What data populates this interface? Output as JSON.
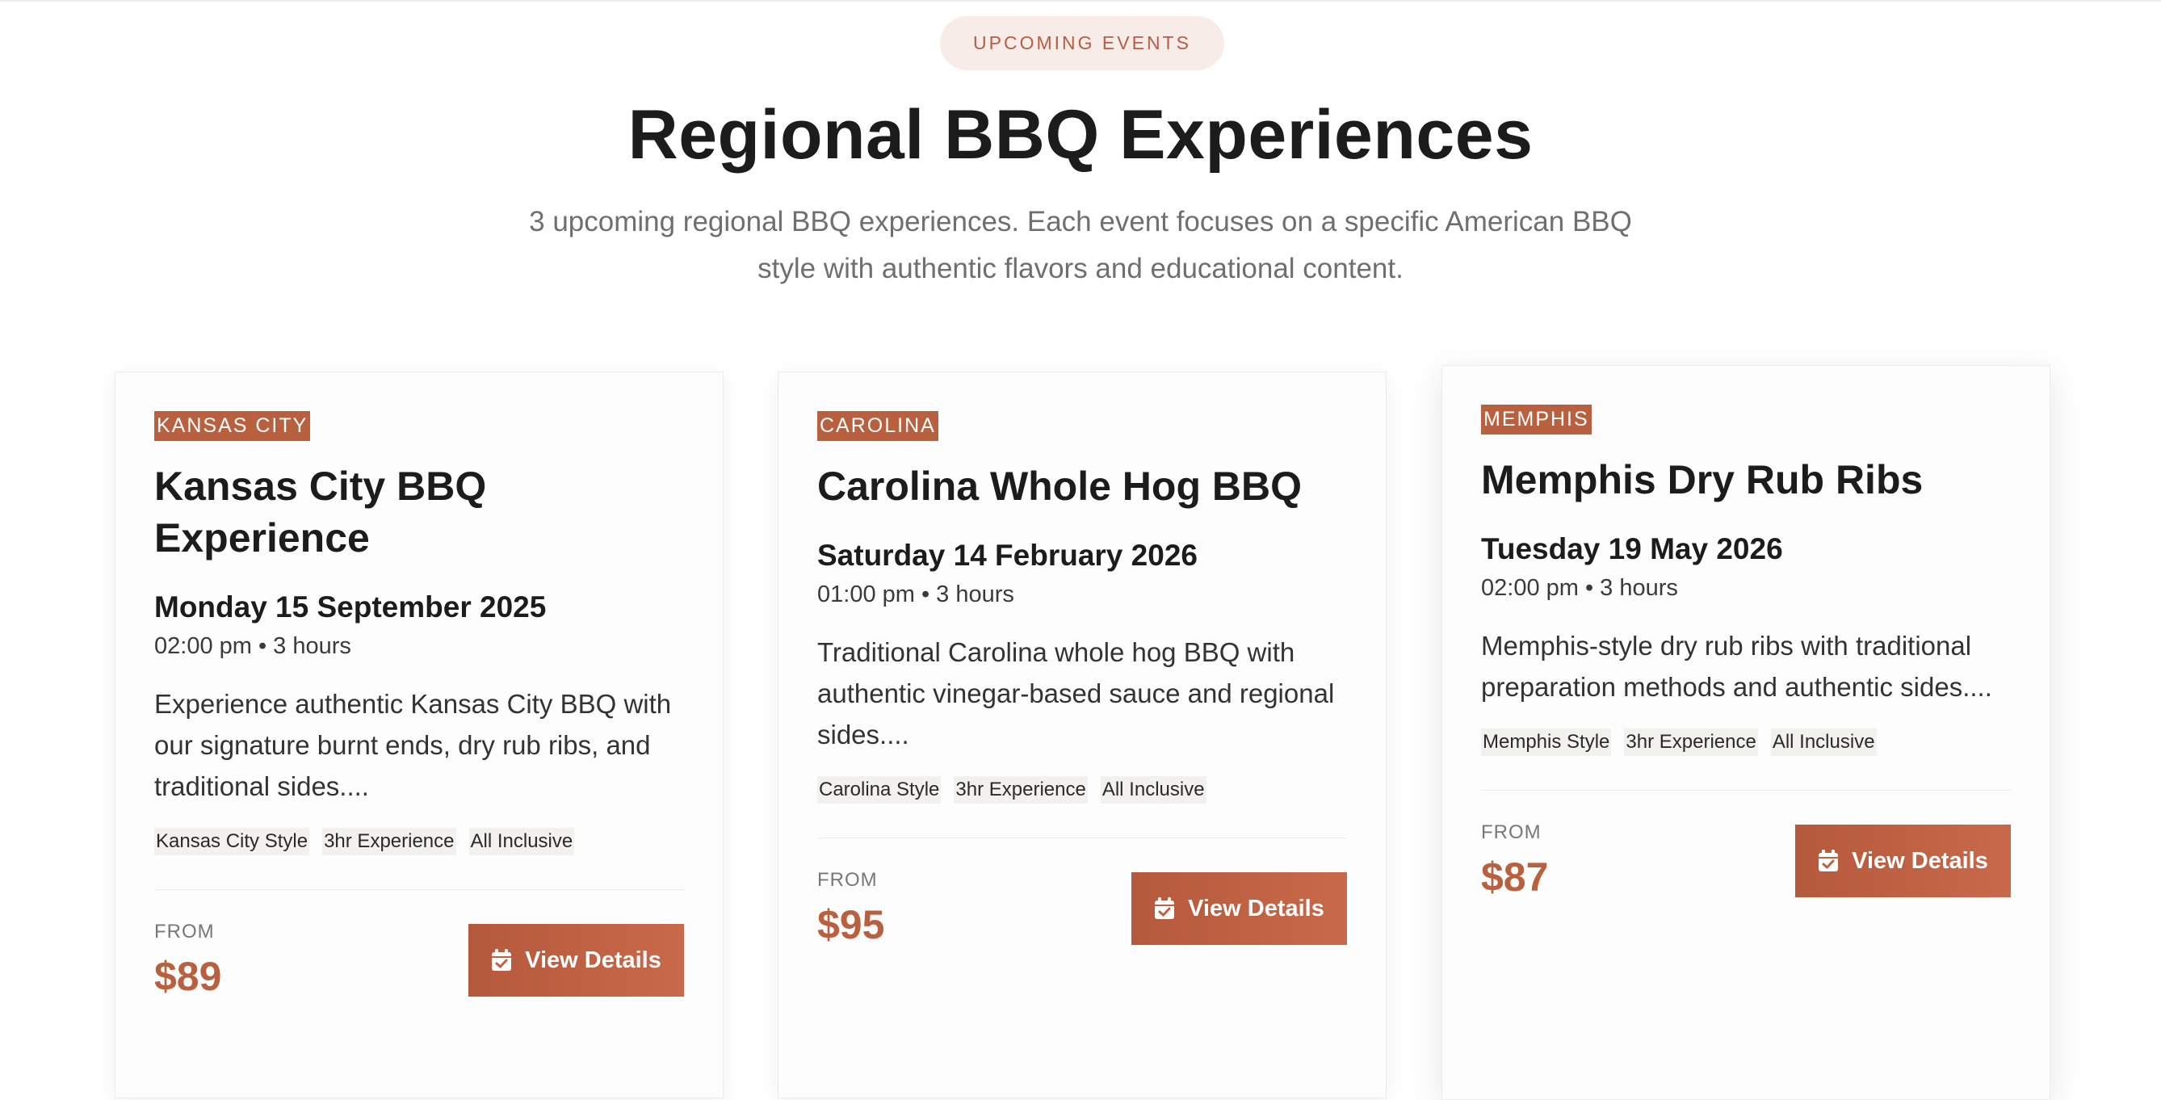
{
  "hero": {
    "badge": "UPCOMING EVENTS",
    "title": "Regional BBQ Experiences",
    "subtitle": "3 upcoming regional BBQ experiences. Each event focuses on a specific American BBQ style with authentic flavors and educational content."
  },
  "colors": {
    "accent": "#b9603f",
    "badge_bg": "#f8ece8",
    "tag_bg": "#f3f1ed"
  },
  "events": [
    {
      "region": "KANSAS CITY",
      "title": "Kansas City BBQ Experience",
      "date": "Monday 15 September 2025",
      "time": "02:00 pm • 3 hours",
      "description": "Experience authentic Kansas City BBQ with our signature burnt ends, dry rub ribs, and traditional sides....",
      "tags": [
        "Kansas City Style",
        "3hr Experience",
        "All Inclusive"
      ],
      "from_label": "FROM",
      "price": "$89",
      "button": "View Details",
      "button_icon": "calendar-check-icon"
    },
    {
      "region": "CAROLINA",
      "title": "Carolina Whole Hog BBQ",
      "date": "Saturday 14 February 2026",
      "time": "01:00 pm • 3 hours",
      "description": "Traditional Carolina whole hog BBQ with authentic vinegar-based sauce and regional sides....",
      "tags": [
        "Carolina Style",
        "3hr Experience",
        "All Inclusive"
      ],
      "from_label": "FROM",
      "price": "$95",
      "button": "View Details",
      "button_icon": "calendar-check-icon"
    },
    {
      "region": "MEMPHIS",
      "title": "Memphis Dry Rub Ribs",
      "date": "Tuesday 19 May 2026",
      "time": "02:00 pm • 3 hours",
      "description": "Memphis-style dry rub ribs with traditional preparation methods and authentic sides....",
      "tags": [
        "Memphis Style",
        "3hr Experience",
        "All Inclusive"
      ],
      "from_label": "FROM",
      "price": "$87",
      "button": "View Details",
      "button_icon": "calendar-check-icon"
    }
  ]
}
